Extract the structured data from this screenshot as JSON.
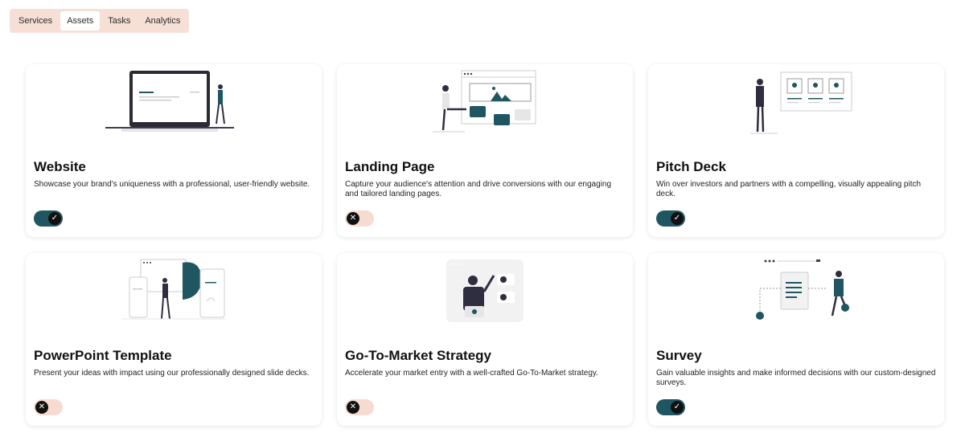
{
  "tabs": [
    {
      "label": "Services",
      "active": false
    },
    {
      "label": "Assets",
      "active": true
    },
    {
      "label": "Tasks",
      "active": false
    },
    {
      "label": "Analytics",
      "active": false
    }
  ],
  "colors": {
    "accent": "#1f5661",
    "toggle_off": "#f6dcd0",
    "tabbar": "#f6e0d6"
  },
  "cards": [
    {
      "title": "Website",
      "description": "Showcase your brand's uniqueness with a professional, user-friendly website.",
      "enabled": true,
      "toggle_icon": "check-icon",
      "toggle_glyph": "✓"
    },
    {
      "title": "Landing Page",
      "description": "Capture your audience's attention and drive conversions with our engaging and tailored landing pages.",
      "enabled": false,
      "toggle_icon": "close-icon",
      "toggle_glyph": "✕"
    },
    {
      "title": "Pitch Deck",
      "description": "Win over investors and partners with a compelling, visually appealing pitch deck.",
      "enabled": true,
      "toggle_icon": "check-icon",
      "toggle_glyph": "✓"
    },
    {
      "title": "PowerPoint Template",
      "description": "Present your ideas with impact using our professionally designed slide decks.",
      "enabled": false,
      "toggle_icon": "close-icon",
      "toggle_glyph": "✕"
    },
    {
      "title": "Go-To-Market Strategy",
      "description": "Accelerate your market entry with a well-crafted Go-To-Market strategy.",
      "enabled": false,
      "toggle_icon": "close-icon",
      "toggle_glyph": "✕"
    },
    {
      "title": "Survey",
      "description": "Gain valuable insights and make informed decisions with our custom-designed surveys.",
      "enabled": true,
      "toggle_icon": "check-icon",
      "toggle_glyph": "✓"
    }
  ]
}
